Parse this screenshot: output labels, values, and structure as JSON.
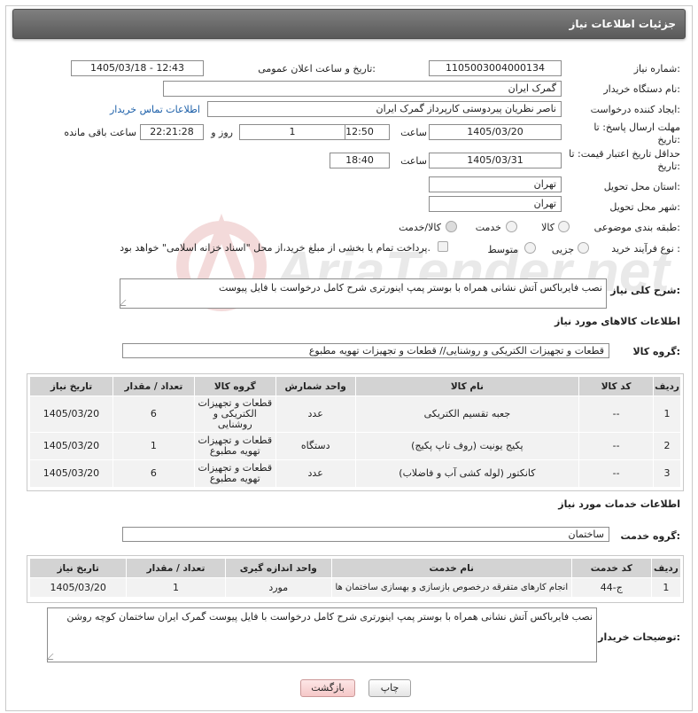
{
  "header": {
    "title": "جزئیات اطلاعات نیاز"
  },
  "labels": {
    "need_number": "شماره نیاز:",
    "announce_datetime": "تاریخ و ساعت اعلان عمومی:",
    "buyer_org": "نام دستگاه خریدار:",
    "requester": "ایجاد کننده درخواست:",
    "reply_deadline": "مهلت ارسال پاسخ: تا تاریخ:",
    "hour1": "ساعت",
    "day_and": "روز و",
    "remaining": "ساعت باقی مانده",
    "price_validity": "حداقل تاریخ اعتبار قیمت: تا تاریخ:",
    "hour2": "ساعت",
    "province": "استان محل تحویل:",
    "city": "شهر محل تحویل:",
    "category": "طبقه بندی موضوعی:",
    "process_type": "نوع فرآیند خرید :",
    "description": "شرح کلی نیاز:",
    "goods_title": "اطلاعات کالاهای مورد نیاز",
    "goods_group": "گروه کالا:",
    "services_title": "اطلاعات خدمات مورد نیاز",
    "service_group": "گروه خدمت:",
    "buyer_notes": "توضیحات خریدار:"
  },
  "fields": {
    "need_number": "1105003004000134",
    "announce_datetime": "1405/03/18 - 12:43",
    "buyer_org": "گمرک ایران",
    "requester": "ناصر نظریان پیردوستی کارپرداز گمرک ایران",
    "contact_link": "اطلاعات تماس خریدار",
    "reply_date": "1405/03/20",
    "reply_time": "12:50",
    "days": "1",
    "remaining_time": "22:21:28",
    "validity_date": "1405/03/31",
    "validity_time": "18:40",
    "province": "تهران",
    "city": "تهران",
    "goods_group": "قطعات و تجهیزات الکتریکی و روشنایی//  قطعات و تجهیزات تهویه مطبوع",
    "service_group": "ساختمان"
  },
  "category_options": [
    "کالا",
    "خدمت",
    "کالا/خدمت"
  ],
  "process_options": [
    "جزیی",
    "متوسط"
  ],
  "payment_note": "پرداخت تمام یا بخشی از مبلغ خرید،از محل \"اسناد خزانه اسلامی\" خواهد بود.",
  "description": "نصب فایرباکس آتش نشانی همراه با بوستر پمپ اینورتری شرح کامل درخواست با فایل پیوست",
  "goods_table": {
    "headers": [
      "ردیف",
      "کد کالا",
      "نام کالا",
      "واحد شمارش",
      "گروه کالا",
      "تعداد / مقدار",
      "تاریخ نیاز"
    ],
    "rows": [
      [
        "1",
        "--",
        "جعبه تقسیم الکتریکی",
        "عدد",
        "قطعات و تجهیزات الکتریکی و روشنایی",
        "6",
        "1405/03/20"
      ],
      [
        "2",
        "--",
        "پکیج یونیت (روف تاپ پکیج)",
        "دستگاه",
        "قطعات و تجهیزات تهویه مطبوع",
        "1",
        "1405/03/20"
      ],
      [
        "3",
        "--",
        "کانکتور (لوله کشی آب و فاضلاب)",
        "عدد",
        "قطعات و تجهیزات تهویه مطبوع",
        "6",
        "1405/03/20"
      ]
    ]
  },
  "services_table": {
    "headers": [
      "ردیف",
      "کد خدمت",
      "نام خدمت",
      "واحد اندازه گیری",
      "تعداد / مقدار",
      "تاریخ نیاز"
    ],
    "rows": [
      [
        "1",
        "ج-44",
        "انجام کارهای متفرقه درخصوص بازسازی و بهسازی ساختمان ها",
        "مورد",
        "1",
        "1405/03/20"
      ]
    ]
  },
  "buyer_notes": "نصب فایرباکس آتش نشانی همراه با بوستر پمپ اینورتری شرح کامل درخواست با فایل پیوست  گمرک ایران ساختمان کوچه روشن",
  "buttons": {
    "print": "چاپ",
    "back": "بازگشت"
  },
  "watermark": "AriaTender.net"
}
